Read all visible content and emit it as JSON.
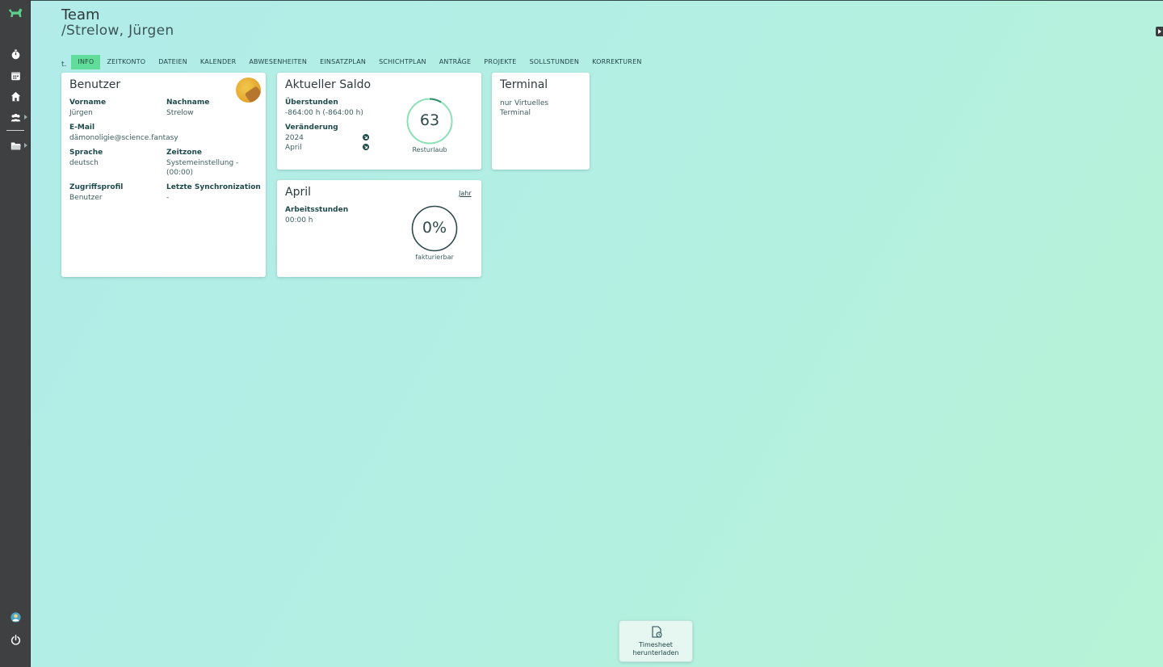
{
  "header": {
    "title": "Team",
    "subtitle": "/Strelow, Jürgen"
  },
  "tabs": {
    "marker": "t.",
    "items": [
      {
        "label": "INFO",
        "active": true
      },
      {
        "label": "ZEITKONTO"
      },
      {
        "label": "DATEIEN"
      },
      {
        "label": "KALENDER"
      },
      {
        "label": "ABWESENHEITEN"
      },
      {
        "label": "EINSATZPLAN"
      },
      {
        "label": "SCHICHTPLAN"
      },
      {
        "label": "ANTRÄGE"
      },
      {
        "label": "PROJEKTE"
      },
      {
        "label": "SOLLSTUNDEN"
      },
      {
        "label": "KORREKTUREN"
      }
    ]
  },
  "benutzer": {
    "title": "Benutzer",
    "vorname_label": "Vorname",
    "vorname": "Jürgen",
    "nachname_label": "Nachname",
    "nachname": "Strelow",
    "email_label": "E-Mail",
    "email": "dämonoligie@science.fantasy",
    "sprache_label": "Sprache",
    "sprache": "deutsch",
    "zeitzone_label": "Zeitzone",
    "zeitzone_line1": "Systemeinstellung -",
    "zeitzone_line2": "(00:00)",
    "zugriff_label": "Zugriffsprofil",
    "zugriff": "Benutzer",
    "sync_label": "Letzte Synchronization",
    "sync": "-"
  },
  "saldo": {
    "title": "Aktueller Saldo",
    "ueberstunden_label": "Überstunden",
    "ueberstunden": "-864:00 h (-864:00 h)",
    "veraenderung_label": "Veränderung",
    "year": "2024",
    "month": "April",
    "resturlaub_value": "63",
    "resturlaub_label": "Resturlaub"
  },
  "terminal": {
    "title": "Terminal",
    "line1": "nur Virtuelles",
    "line2": "Terminal"
  },
  "april": {
    "title": "April",
    "jahr_link": "Jahr",
    "arbeitsstunden_label": "Arbeitsstunden",
    "arbeitsstunden": "00:00 h",
    "percent": "0%",
    "percent_label": "fakturierbar"
  },
  "download": {
    "line1": "Timesheet",
    "line2": "herunterladen"
  },
  "colors": {
    "accent": "#62dc9a",
    "sidebar": "#3e4041",
    "ring": "#8be0b5",
    "text": "#1f4a4c"
  },
  "sidebar_icons": [
    "dog-logo-icon",
    "stopwatch-icon",
    "calendar-icon",
    "home-icon",
    "team-icon",
    "folder-icon",
    "user-avatar-icon",
    "power-icon"
  ]
}
